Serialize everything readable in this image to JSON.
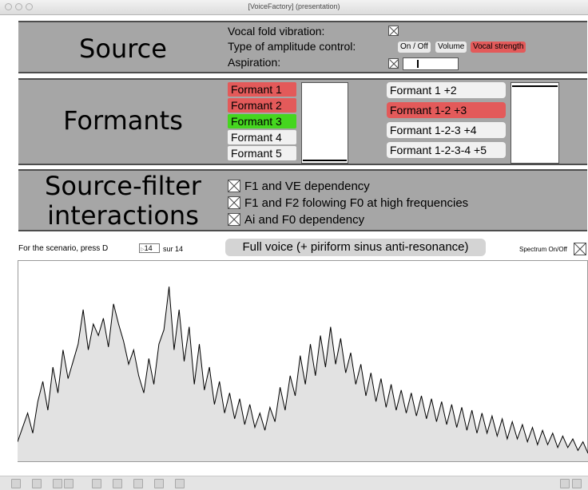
{
  "window": {
    "title": "[VoiceFactory] (presentation)"
  },
  "source": {
    "heading": "Source",
    "vocal_fold_label": "Vocal fold vibration:",
    "amplitude_label": "Type of amplitude control:",
    "amplitude_options": [
      {
        "label": "On / Off",
        "selected": false
      },
      {
        "label": "Volume",
        "selected": false
      },
      {
        "label": "Vocal strength",
        "selected": true
      }
    ],
    "aspiration_label": "Aspiration:",
    "aspiration_slider_level": 0.24
  },
  "formants": {
    "heading": "Formants",
    "list1": [
      {
        "label": "Formant 1",
        "state": "red"
      },
      {
        "label": "Formant 2",
        "state": "red"
      },
      {
        "label": "Formant 3",
        "state": "green"
      },
      {
        "label": "Formant 4",
        "state": "off"
      },
      {
        "label": "Formant 5",
        "state": "off"
      }
    ],
    "slider1_level": 0.02,
    "list2": [
      {
        "label": "Formant 1 +2",
        "state": "off"
      },
      {
        "label": "Formant 1-2 +3",
        "state": "red"
      },
      {
        "label": "Formant 1-2-3 +4",
        "state": "off"
      },
      {
        "label": "Formant 1-2-3-4 +5",
        "state": "off"
      }
    ],
    "slider2_level": 0.99
  },
  "interactions": {
    "heading_line1": "Source-filter",
    "heading_line2": "interactions",
    "options": [
      {
        "label": "F1 and VE dependency"
      },
      {
        "label": "F1 and F2 folowing F0 at high frequencies"
      },
      {
        "label": "Ai and F0 dependency"
      }
    ]
  },
  "scenario": {
    "prompt": "For the scenario, press D",
    "current": "14",
    "total_label": "sur 14",
    "mode_label": "Full voice (+ piriform sinus anti-resonance)",
    "spectrum_label": "Spectrum On/Off"
  },
  "spectrum": {
    "values": [
      4,
      9,
      14,
      7,
      18,
      25,
      15,
      30,
      21,
      36,
      26,
      32,
      38,
      50,
      36,
      45,
      41,
      47,
      37,
      52,
      45,
      39,
      31,
      36,
      27,
      21,
      33,
      24,
      38,
      43,
      58,
      36,
      50,
      32,
      44,
      24,
      38,
      22,
      30,
      17,
      25,
      14,
      21,
      12,
      19,
      10,
      17,
      9,
      14,
      8,
      16,
      11,
      23,
      15,
      27,
      20,
      34,
      24,
      38,
      27,
      41,
      30,
      44,
      31,
      40,
      28,
      35,
      24,
      31,
      20,
      28,
      18,
      26,
      16,
      24,
      15,
      22,
      14,
      21,
      13,
      20,
      12,
      19,
      11,
      18,
      10,
      17,
      9,
      16,
      8,
      15,
      7,
      14,
      7,
      13,
      6,
      12,
      5,
      11,
      5,
      10,
      4,
      9,
      3,
      8,
      3,
      7,
      2,
      6,
      2,
      5,
      1,
      4,
      0
    ]
  }
}
